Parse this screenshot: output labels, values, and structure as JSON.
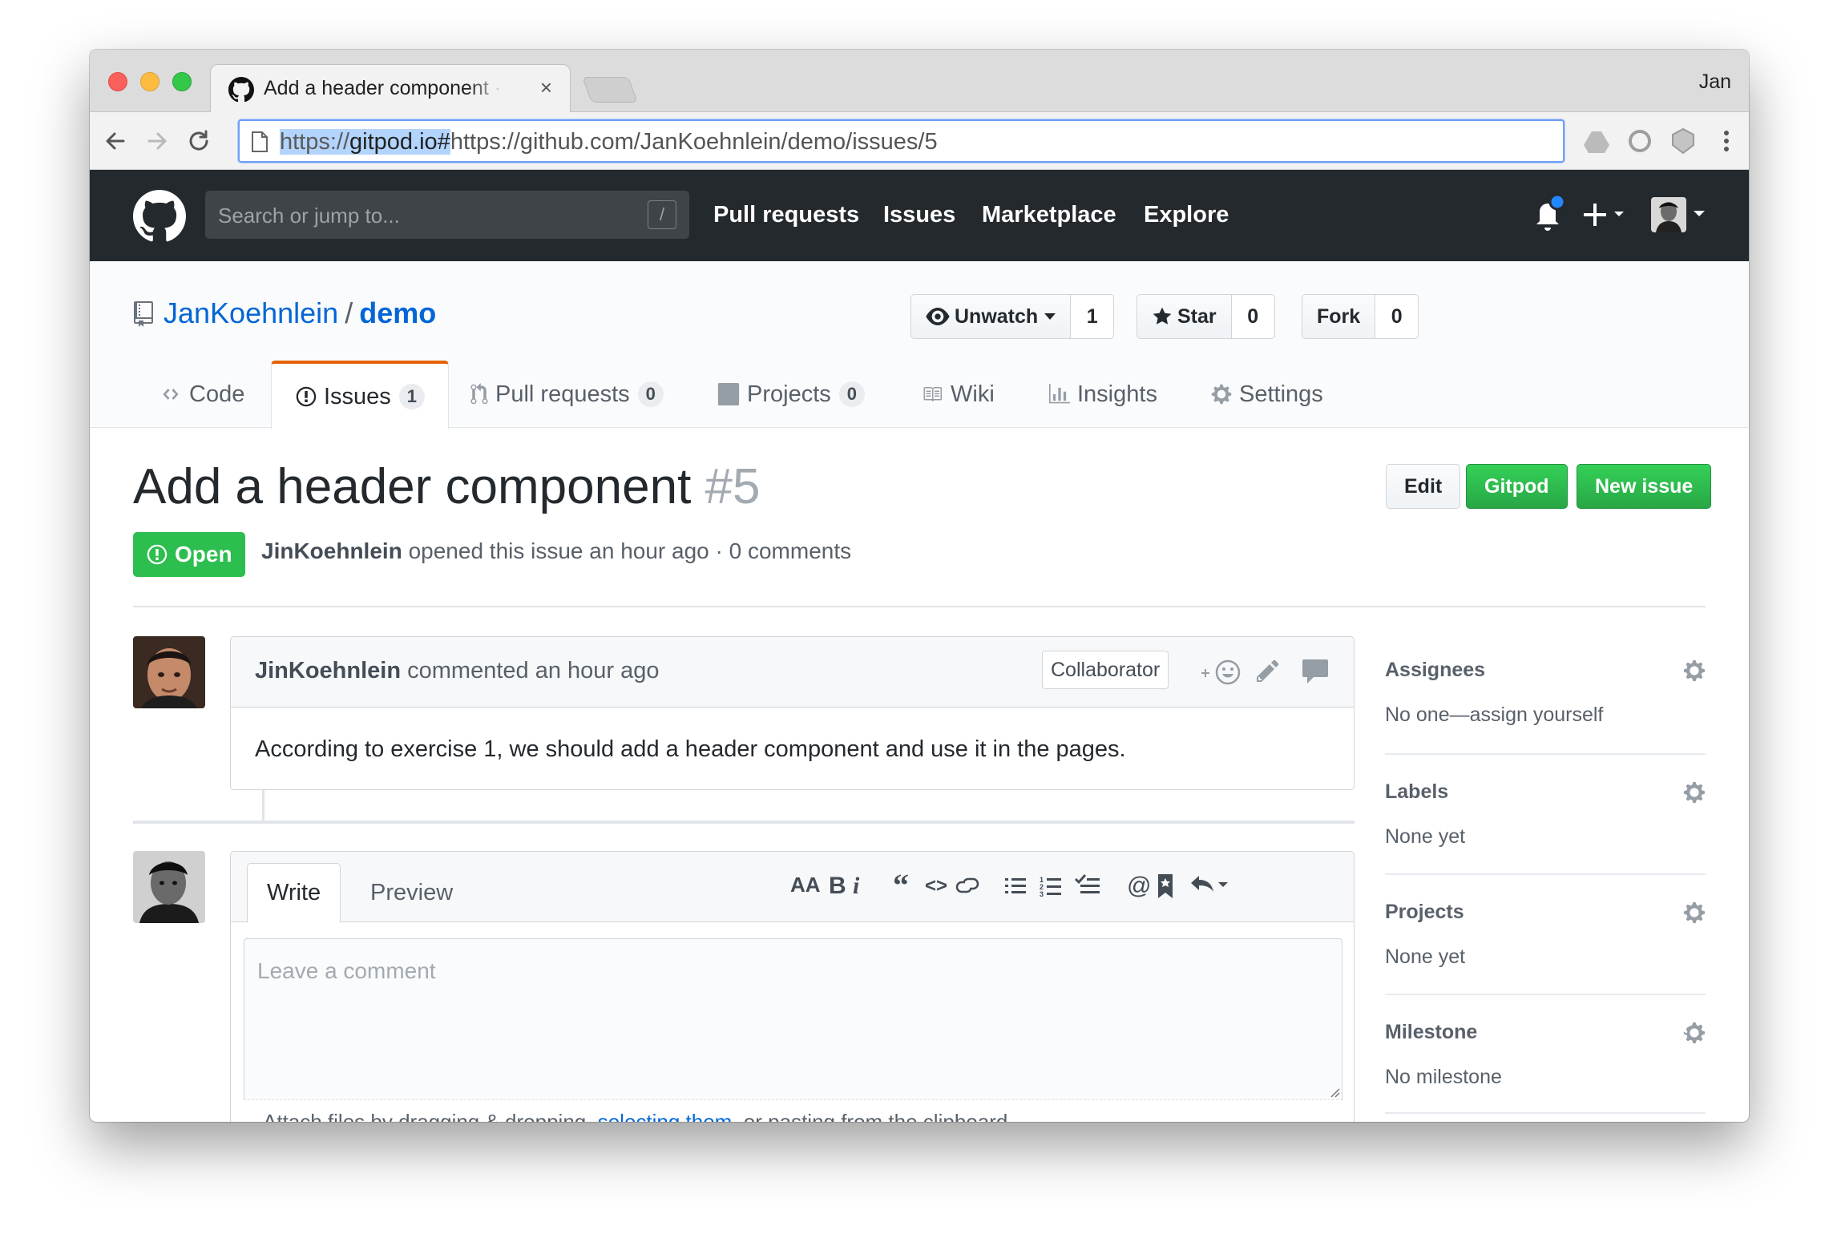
{
  "browser": {
    "tab_title": "Add a header component · Issues",
    "tab_close": "×",
    "profile": "Jan",
    "url_highlight_scheme": "https://",
    "url_highlight_host": "gitpod.io#",
    "url_rest": "https://github.com/JanKoehnlein/demo/issues/5"
  },
  "gh_header": {
    "search_placeholder": "Search or jump to...",
    "search_shortcut": "/",
    "nav": [
      "Pull requests",
      "Issues",
      "Marketplace",
      "Explore"
    ],
    "plus": "+"
  },
  "repo": {
    "owner": "JanKoehnlein",
    "separator": "/",
    "name": "demo",
    "watch_label": "Unwatch",
    "watch_count": "1",
    "star_label": "Star",
    "star_count": "0",
    "fork_label": "Fork",
    "fork_count": "0",
    "tabs": [
      {
        "label": "Code"
      },
      {
        "label": "Issues",
        "count": "1"
      },
      {
        "label": "Pull requests",
        "count": "0"
      },
      {
        "label": "Projects",
        "count": "0"
      },
      {
        "label": "Wiki"
      },
      {
        "label": "Insights"
      },
      {
        "label": "Settings"
      }
    ]
  },
  "issue": {
    "title": "Add a header component",
    "number": "#5",
    "state": "Open",
    "author": "JinKoehnlein",
    "meta_text": "opened this issue an hour ago · 0 comments",
    "buttons": {
      "edit": "Edit",
      "gitpod": "Gitpod",
      "new_issue": "New issue"
    }
  },
  "comment": {
    "author": "JinKoehnlein",
    "time_text": "commented an hour ago",
    "badge": "Collaborator",
    "body": "According to exercise 1, we should add a header component and use it in the pages."
  },
  "new_comment": {
    "tab_write": "Write",
    "tab_preview": "Preview",
    "toolbar": {
      "heading": "AA",
      "bold": "B",
      "italic": "i",
      "quote": "“",
      "code": "<>",
      "mention": "@"
    },
    "placeholder": "Leave a comment",
    "attach_prefix": "Attach files by dragging & dropping, ",
    "attach_link": "selecting them",
    "attach_suffix": ", or pasting from the clipboard."
  },
  "sidebar": [
    {
      "title": "Assignees",
      "value": "No one—assign yourself"
    },
    {
      "title": "Labels",
      "value": "None yet"
    },
    {
      "title": "Projects",
      "value": "None yet"
    },
    {
      "title": "Milestone",
      "value": "No milestone"
    }
  ],
  "colors": {
    "header_bg": "#24292e",
    "link_blue": "#0366d6",
    "open_green": "#2cbe4e",
    "tab_accent": "#e36209"
  }
}
